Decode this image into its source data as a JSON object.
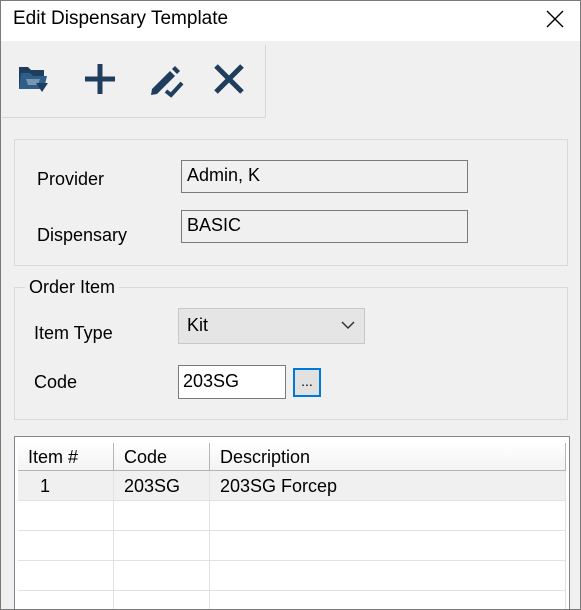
{
  "window": {
    "title": "Edit Dispensary Template"
  },
  "toolbar": {
    "items": [
      {
        "name": "open-folder",
        "label": ""
      },
      {
        "name": "add",
        "label": ""
      },
      {
        "name": "edit",
        "label": ""
      },
      {
        "name": "delete",
        "label": ""
      }
    ]
  },
  "header_fields": {
    "provider_label": "Provider",
    "provider_value": "Admin, K",
    "dispensary_label": "Dispensary",
    "dispensary_value": "BASIC"
  },
  "order_item": {
    "legend": "Order Item",
    "item_type_label": "Item Type",
    "item_type_value": "Kit",
    "code_label": "Code",
    "code_value": "203SG",
    "browse_label": "..."
  },
  "grid": {
    "columns": [
      "Item #",
      "Code",
      "Description"
    ],
    "rows": [
      {
        "item_no": "1",
        "code": "203SG",
        "description": "203SG Forcep"
      }
    ]
  }
}
